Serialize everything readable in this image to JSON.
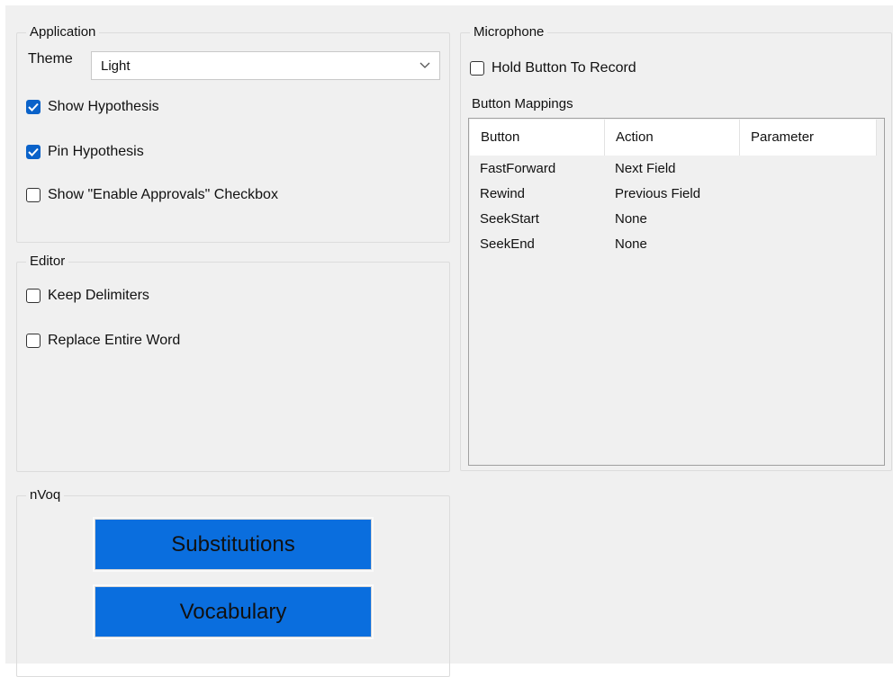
{
  "application": {
    "legend": "Application",
    "theme_label": "Theme",
    "theme_value": "Light",
    "options": [
      {
        "label": "Show Hypothesis",
        "checked": true
      },
      {
        "label": "Pin Hypothesis",
        "checked": true
      },
      {
        "label": "Show \"Enable Approvals\" Checkbox",
        "checked": false
      }
    ]
  },
  "editor": {
    "legend": "Editor",
    "options": [
      {
        "label": "Keep Delimiters",
        "checked": false
      },
      {
        "label": "Replace Entire Word",
        "checked": false
      }
    ]
  },
  "microphone": {
    "legend": "Microphone",
    "hold_to_record": {
      "label": "Hold Button To Record",
      "checked": false
    },
    "mappings_label": "Button Mappings",
    "columns": [
      "Button",
      "Action",
      "Parameter"
    ],
    "rows": [
      [
        "FastForward",
        "Next Field",
        ""
      ],
      [
        "Rewind",
        "Previous Field",
        ""
      ],
      [
        "SeekStart",
        "None",
        ""
      ],
      [
        "SeekEnd",
        "None",
        ""
      ]
    ]
  },
  "nvoq": {
    "legend": "nVoq",
    "substitutions_label": "Substitutions",
    "vocabulary_label": "Vocabulary"
  },
  "colors": {
    "accent": "#0a62c9",
    "button": "#0a6ede",
    "panel": "#f0f0f0"
  }
}
